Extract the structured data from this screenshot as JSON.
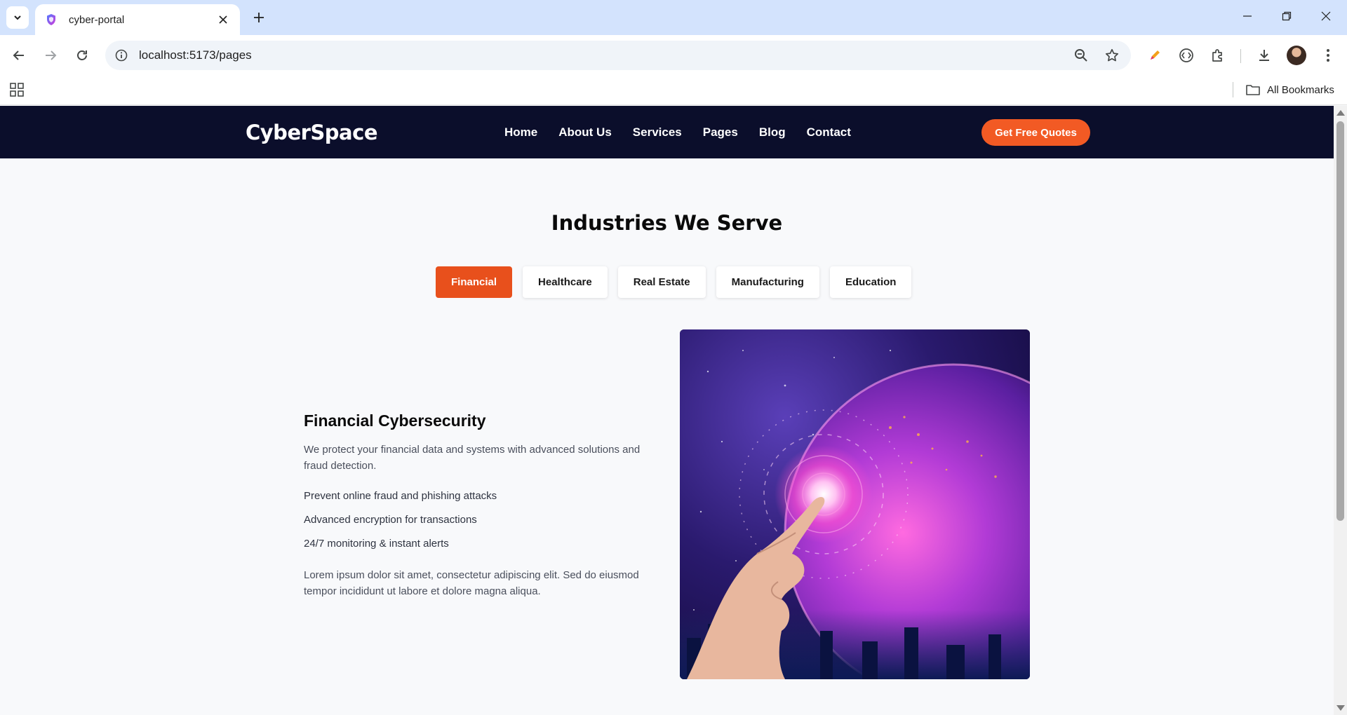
{
  "browser": {
    "tab_title": "cyber-portal",
    "url": "localhost:5173/pages",
    "bookmarks_label": "All Bookmarks"
  },
  "site": {
    "logo": "CyberSpace",
    "nav": [
      "Home",
      "About Us",
      "Services",
      "Pages",
      "Blog",
      "Contact"
    ],
    "cta": "Get Free Quotes"
  },
  "industries": {
    "title": "Industries We Serve",
    "tabs": [
      "Financial",
      "Healthcare",
      "Real Estate",
      "Manufacturing",
      "Education"
    ],
    "active_tab": "Financial"
  },
  "content": {
    "title": "Financial Cybersecurity",
    "description": "We protect your financial data and systems with advanced solutions and fraud detection.",
    "features": [
      "Prevent online fraud and phishing attacks",
      "Advanced encryption for transactions",
      "24/7 monitoring & instant alerts"
    ],
    "lorem": "Lorem ipsum dolor sit amet, consectetur adipiscing elit. Sed do eiusmod tempor incididunt ut labore et dolore magna aliqua."
  },
  "colors": {
    "header_bg": "#0b0e2b",
    "accent": "#e8501c",
    "cta": "#f25a24"
  }
}
